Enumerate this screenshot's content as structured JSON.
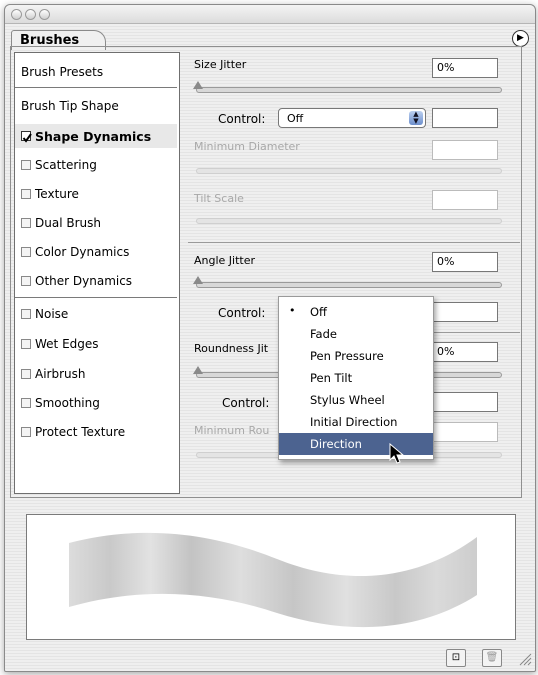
{
  "window": {
    "title": ""
  },
  "panel": {
    "tab_label": "Brushes"
  },
  "sidebar": {
    "items": [
      {
        "label": "Brush Presets"
      },
      {
        "label": "Brush Tip Shape"
      },
      {
        "label": "Shape Dynamics",
        "checked": true
      },
      {
        "label": "Scattering",
        "checked": false
      },
      {
        "label": "Texture",
        "checked": false
      },
      {
        "label": "Dual Brush",
        "checked": false
      },
      {
        "label": "Color Dynamics",
        "checked": false
      },
      {
        "label": "Other Dynamics",
        "checked": false
      },
      {
        "label": "Noise",
        "checked": false
      },
      {
        "label": "Wet Edges",
        "checked": false
      },
      {
        "label": "Airbrush",
        "checked": false
      },
      {
        "label": "Smoothing",
        "checked": false
      },
      {
        "label": "Protect Texture",
        "checked": false
      }
    ]
  },
  "settings": {
    "size_jitter": {
      "label": "Size Jitter",
      "value": "0%"
    },
    "size_control": {
      "label": "Control:",
      "value": "Off",
      "field": ""
    },
    "minimum_diameter": {
      "label": "Minimum Diameter",
      "value": ""
    },
    "tilt_scale": {
      "label": "Tilt Scale",
      "value": ""
    },
    "angle_jitter": {
      "label": "Angle Jitter",
      "value": "0%"
    },
    "angle_control": {
      "label": "Control:",
      "field": ""
    },
    "roundness_jitter": {
      "label": "Roundness Jit",
      "value": "0%"
    },
    "roundness_control": {
      "label": "Control:",
      "field": ""
    },
    "minimum_roundness": {
      "label": "Minimum Rou",
      "value": ""
    }
  },
  "popup_menu": {
    "selected": "Off",
    "highlighted": "Direction",
    "options": [
      "Off",
      "Fade",
      "Pen Pressure",
      "Pen Tilt",
      "Stylus Wheel",
      "Initial Direction",
      "Direction"
    ]
  },
  "colors": {
    "highlight": "#4c6390",
    "panel_bg": "#ececec"
  },
  "icons": {
    "panel_menu": "triangle-right-icon",
    "new_brush": "new-brush-icon",
    "trash": "trash-icon"
  }
}
